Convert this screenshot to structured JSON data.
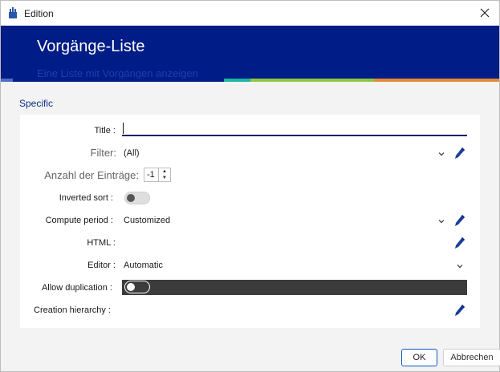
{
  "window": {
    "title": "Edition"
  },
  "banner": {
    "title": "Vorgänge-Liste",
    "subtitle": "Eine Liste mit Vorgängen anzeigen",
    "stripe_colors": [
      "#0a2a8a",
      "#0a2a8a",
      "#1fb3a3",
      "#8fc641",
      "#e38a3a"
    ]
  },
  "section": {
    "title": "Specific"
  },
  "form": {
    "title_label": "Title :",
    "title_value": "",
    "filter_label": "Filter:",
    "filter_value": "(All)",
    "entries_label": "Anzahl der Einträge:",
    "entries_value": "-1",
    "inverted_sort_label": "Inverted sort :",
    "inverted_sort_on": false,
    "compute_period_label": "Compute period :",
    "compute_period_value": "Customized",
    "html_label": "HTML :",
    "editor_label": "Editor :",
    "editor_value": "Automatic",
    "allow_duplication_label": "Allow duplication :",
    "allow_duplication_on": false,
    "creation_hierarchy_label": "Creation hierarchy :"
  },
  "buttons": {
    "ok": "OK",
    "cancel": "Abbrechen"
  },
  "icons": {
    "app": "app-icon",
    "close": "close-icon",
    "chevron": "chevron-down-icon",
    "edit": "pencil-icon"
  },
  "colors": {
    "banner_bg": "#001c86",
    "accent": "#0a5bc4",
    "section_title": "#0b2d8a"
  }
}
